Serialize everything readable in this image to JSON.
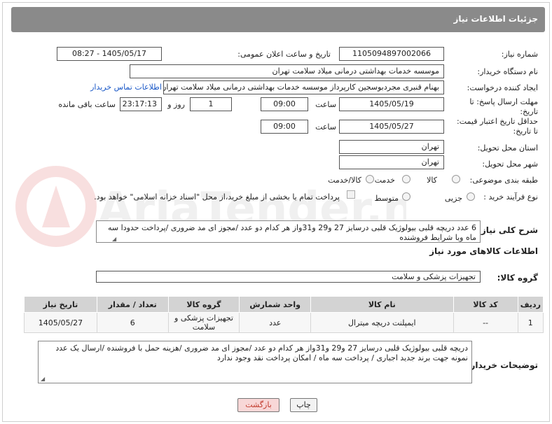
{
  "header": {
    "title": "جزئیات اطلاعات نیاز"
  },
  "form": {
    "need_number_label": "شماره نیاز:",
    "need_number": "1105094897002066",
    "announce_label": "تاریخ و ساعت اعلان عمومی:",
    "announce_value": "1405/05/17 - 08:27",
    "buyer_org_label": "نام دستگاه خریدار:",
    "buyer_org": "موسسه خدمات بهداشتی درمانی میلاد سلامت تهران",
    "creator_label": "ایجاد کننده درخواست:",
    "creator": "بهنام قنبری مجردبوسجین کارپرداز موسسه خدمات بهداشتی درمانی میلاد سلامت تهران",
    "contact_link": "اطلاعات تماس خریدار",
    "deadline_label_1": "مهلت ارسال پاسخ: تا",
    "deadline_label_2": "تاریخ:",
    "deadline_date": "1405/05/19",
    "time_label": "ساعت",
    "deadline_time": "09:00",
    "days_value": "1",
    "days_label": "روز و",
    "remaining_time": "23:17:13",
    "remaining_label": "ساعت باقی مانده",
    "min_price_label_1": "حداقل تاریخ اعتبار قیمت:",
    "min_price_label_2": "تا تاریخ:",
    "min_price_date": "1405/05/27",
    "min_price_time": "09:00",
    "province_label": "استان محل تحویل:",
    "province": "تهران",
    "city_label": "شهر محل تحویل:",
    "city": "تهران",
    "category_label": "طبقه بندی موضوعی:",
    "category_options": [
      "کالا",
      "خدمت",
      "کالا/خدمت"
    ],
    "purchase_type_label": "نوع فرآیند خرید :",
    "purchase_options": [
      "جزیی",
      "متوسط"
    ],
    "payment_note": "پرداخت تمام یا بخشی از مبلغ خرید،از محل \"اسناد خزانه اسلامی\" خواهد بود.",
    "description_label": "شرح کلی نیاز:",
    "description": "6 عدد دریچه قلبی بیولوژیک   قلبی   درسایز 27 و29 و31واز هر کدام دو عدد   /مجوز ای مد ضروری /پرداخت حدودا سه ماه وبا شرایط فروشنده",
    "goods_info_title": "اطلاعات کالاهای مورد نیاز",
    "goods_group_label": "گروه کالا:",
    "goods_group": "تجهیزات پزشکی و سلامت",
    "buyer_notes_label": "توضیحات خریدار:",
    "buyer_notes": "دریچه قلبی بیولوژیک   قلبی   درسایز 27 و29 و31واز هر کدام دو عدد   /مجوز ای مد ضروری /هزینه حمل با فروشنده /ارسال یک عدد نمونه جهت برند جدید اجباری / پرداخت سه ماه / امکان پرداخت نقد وجود ندارد"
  },
  "table": {
    "headers": [
      "ردیف",
      "کد کالا",
      "نام کالا",
      "واحد شمارش",
      "گروه کالا",
      "تعداد / مقدار",
      "تاریخ نیاز"
    ],
    "rows": [
      [
        "1",
        "--",
        "ایمپلنت دریچه میترال",
        "عدد",
        "تجهیزات پزشکی و سلامت",
        "6",
        "1405/05/27"
      ]
    ]
  },
  "buttons": {
    "print": "چاپ",
    "back": "بازگشت"
  },
  "watermark_text": "AriaTender.net",
  "colors": {
    "header_bg": "#8a8a8a",
    "link": "#1a58c7",
    "back_btn": "#f8d7d7",
    "print_btn": "#f2f2f2"
  }
}
